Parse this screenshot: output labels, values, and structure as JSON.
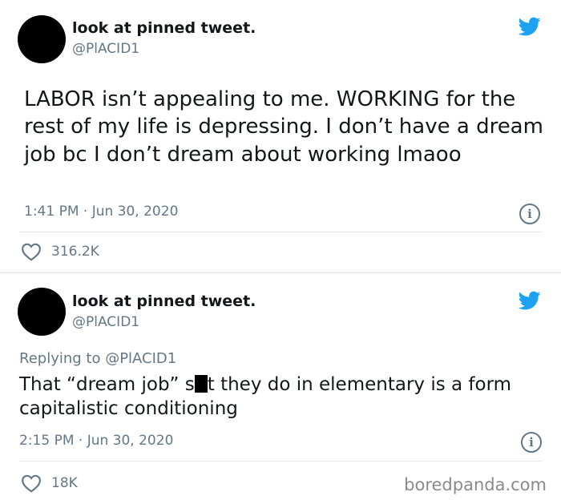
{
  "accent_color": "#1da1f2",
  "muted_color": "#657786",
  "tweets": [
    {
      "display_name": "look at pinned tweet.",
      "handle": "@PlACID1",
      "text": "LABOR isn’t appealing to me. WORKING for the rest of my life is depressing. I don’t have a dream job bc I don’t dream about working lmaoo",
      "timestamp": "1:41 PM · Jun 30, 2020",
      "likes": "316.2K",
      "icons": [
        "twitter-bird-icon",
        "info-icon",
        "heart-icon"
      ]
    },
    {
      "display_name": "look at pinned tweet.",
      "handle": "@PlACID1",
      "replying_to": "Replying to @PlACID1",
      "text_before_censor": "That “dream job” s",
      "text_after_censor": "t they do in elementary is a form capitalistic conditioning",
      "timestamp": "2:15 PM · Jun 30, 2020",
      "likes": "18K",
      "icons": [
        "twitter-bird-icon",
        "info-icon",
        "heart-icon"
      ]
    }
  ],
  "watermark": "boredpanda.com"
}
